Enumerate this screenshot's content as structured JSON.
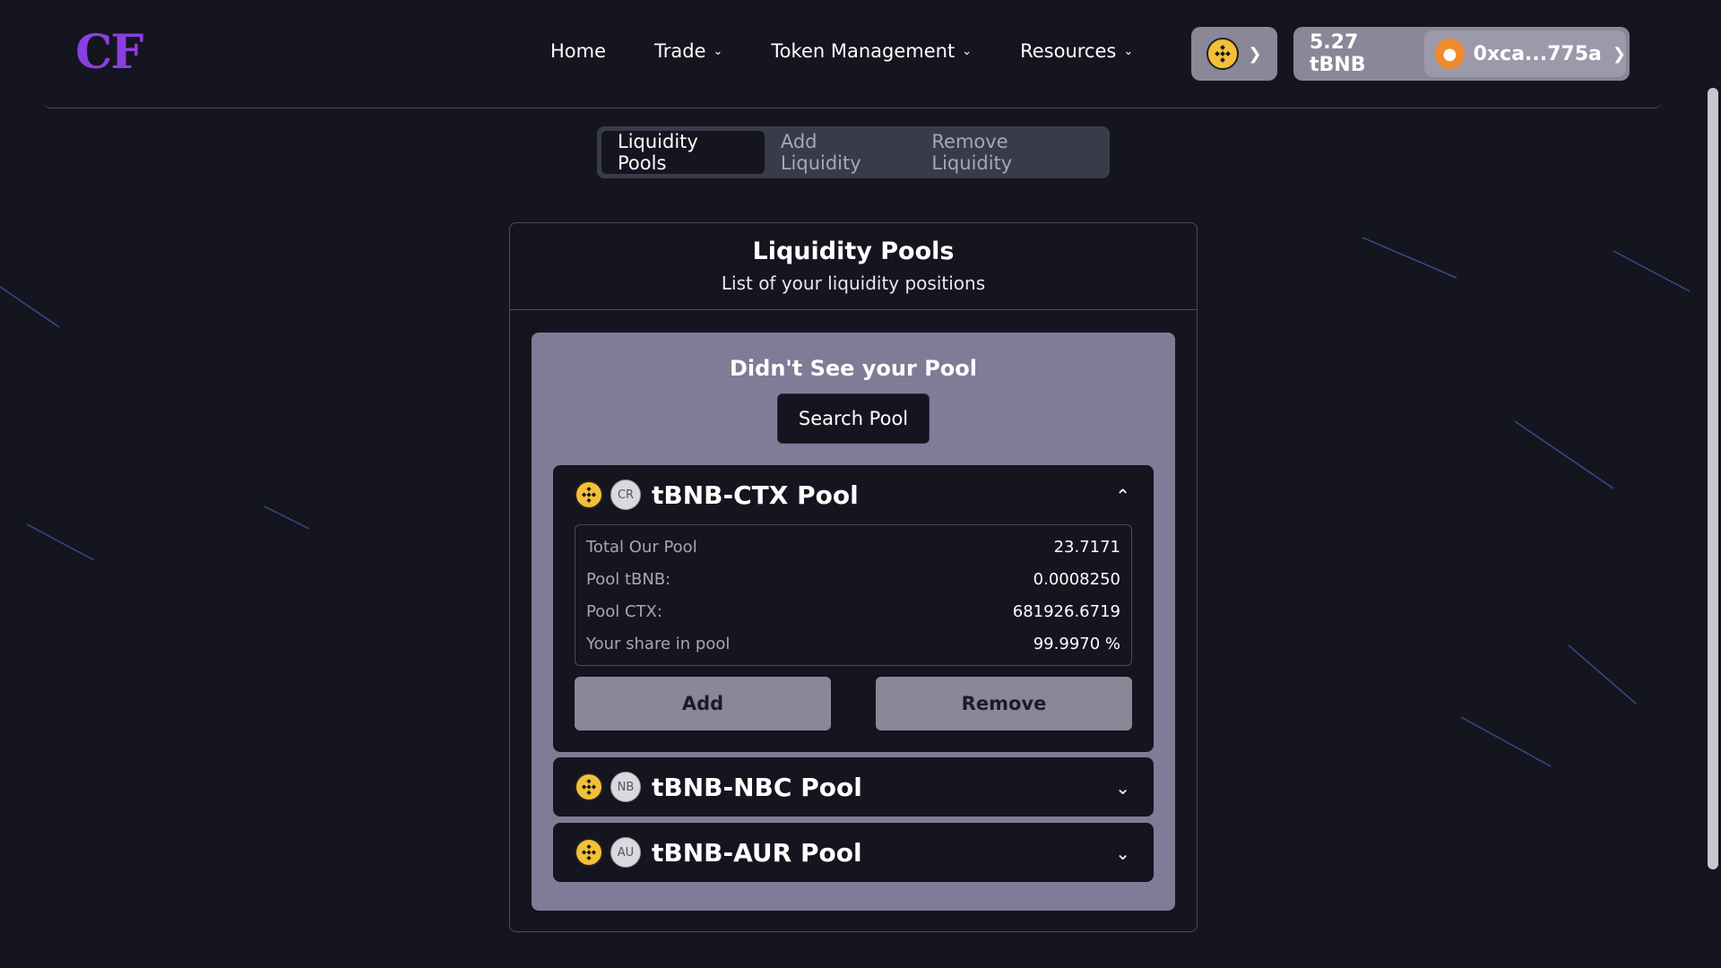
{
  "brand": {
    "logo_text": "CF",
    "logo_color": "#8a3fe0"
  },
  "nav": {
    "items": [
      {
        "label": "Home",
        "has_dropdown": false
      },
      {
        "label": "Trade",
        "has_dropdown": true
      },
      {
        "label": "Token Management",
        "has_dropdown": true
      },
      {
        "label": "Resources",
        "has_dropdown": true
      }
    ]
  },
  "wallet": {
    "balance": "5.27 tBNB",
    "address": "0xca...775a",
    "chain_icon": "bnb-coin-icon"
  },
  "tabs": [
    {
      "label": "Liquidity Pools",
      "active": true
    },
    {
      "label": "Add Liquidity",
      "active": false
    },
    {
      "label": "Remove Liquidity",
      "active": false
    }
  ],
  "card": {
    "title": "Liquidity Pools",
    "subtitle": "List of your liquidity positions",
    "prompt": "Didn't See your Pool",
    "search_label": "Search Pool"
  },
  "pools": [
    {
      "name": "tBNB-CTX Pool",
      "token_badge": "CR",
      "expanded": true,
      "details": [
        {
          "label": "Total Our Pool",
          "value": "23.7171"
        },
        {
          "label": "Pool tBNB:",
          "value": "0.0008250"
        },
        {
          "label": "Pool CTX:",
          "value": "681926.6719"
        },
        {
          "label": "Your share in pool",
          "value": "99.9970 %"
        }
      ],
      "add_label": "Add",
      "remove_label": "Remove"
    },
    {
      "name": "tBNB-NBC Pool",
      "token_badge": "NB",
      "expanded": false
    },
    {
      "name": "tBNB-AUR Pool",
      "token_badge": "AU",
      "expanded": false
    }
  ],
  "colors": {
    "background": "#14151f",
    "panel": "#7e7c96",
    "button": "#8a8799",
    "bnb": "#f3c037"
  }
}
